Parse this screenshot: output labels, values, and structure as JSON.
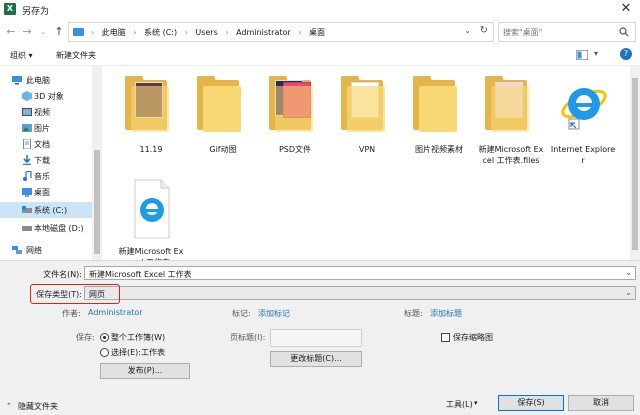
{
  "window": {
    "title": "另存为",
    "app_icon": "X"
  },
  "address": {
    "crumbs": [
      "此电脑",
      "系统 (C:)",
      "Users",
      "Administrator",
      "桌面"
    ]
  },
  "search": {
    "placeholder": "搜索\"桌面\""
  },
  "toolbar": {
    "organize": "组织 ▾",
    "new_folder": "新建文件夹"
  },
  "sidebar": {
    "items": [
      {
        "label": "此电脑",
        "icon": "computer-icon"
      },
      {
        "label": "3D 对象",
        "icon": "cube-icon"
      },
      {
        "label": "视频",
        "icon": "video-icon"
      },
      {
        "label": "图片",
        "icon": "picture-icon"
      },
      {
        "label": "文档",
        "icon": "document-icon"
      },
      {
        "label": "下载",
        "icon": "download-icon"
      },
      {
        "label": "音乐",
        "icon": "music-icon"
      },
      {
        "label": "桌面",
        "icon": "desktop-icon"
      },
      {
        "label": "系统 (C:)",
        "icon": "drive-icon",
        "selected": true
      },
      {
        "label": "本地磁盘 (D:)",
        "icon": "drive-icon"
      },
      {
        "label": "网络",
        "icon": "network-icon"
      }
    ]
  },
  "files": {
    "items": [
      {
        "name": "11.19",
        "type": "folder"
      },
      {
        "name": "Gif动图",
        "type": "folder"
      },
      {
        "name": "PSD文件",
        "type": "folder"
      },
      {
        "name": "VPN",
        "type": "folder"
      },
      {
        "name": "图片视频素材",
        "type": "folder"
      },
      {
        "name": "新建Microsoft Excel 工作表.files",
        "type": "folder"
      },
      {
        "name": "Internet Explorer",
        "type": "shortcut"
      },
      {
        "name": "新建Microsoft Excel 工作表",
        "type": "html-file"
      }
    ]
  },
  "form": {
    "filename_label": "文件名(N):",
    "filename_value": "新建Microsoft Excel 工作表",
    "savetype_label": "保存类型(T):",
    "savetype_value": "网页",
    "author_label": "作者:",
    "author_value": "Administrator",
    "tags_label": "标记:",
    "tags_link": "添加标记",
    "title_label": "标题:",
    "title_link": "添加标题",
    "save_label": "保存:",
    "save_whole": "整个工作簿(W)",
    "save_selection": "选择(E):工作表",
    "page_title_label": "页标题(I):",
    "change_title": "更改标题(C)...",
    "publish": "发布(P)...",
    "thumbnail": "保存缩略图"
  },
  "footer": {
    "hide_folders": "隐藏文件夹",
    "tools": "工具(L)",
    "save": "保存(S)",
    "cancel": "取消"
  },
  "colors": {
    "accent": "#1e73be",
    "highlight_box": "#e02020",
    "selected_bg": "#cce4f7",
    "folder": "#f8d775"
  }
}
